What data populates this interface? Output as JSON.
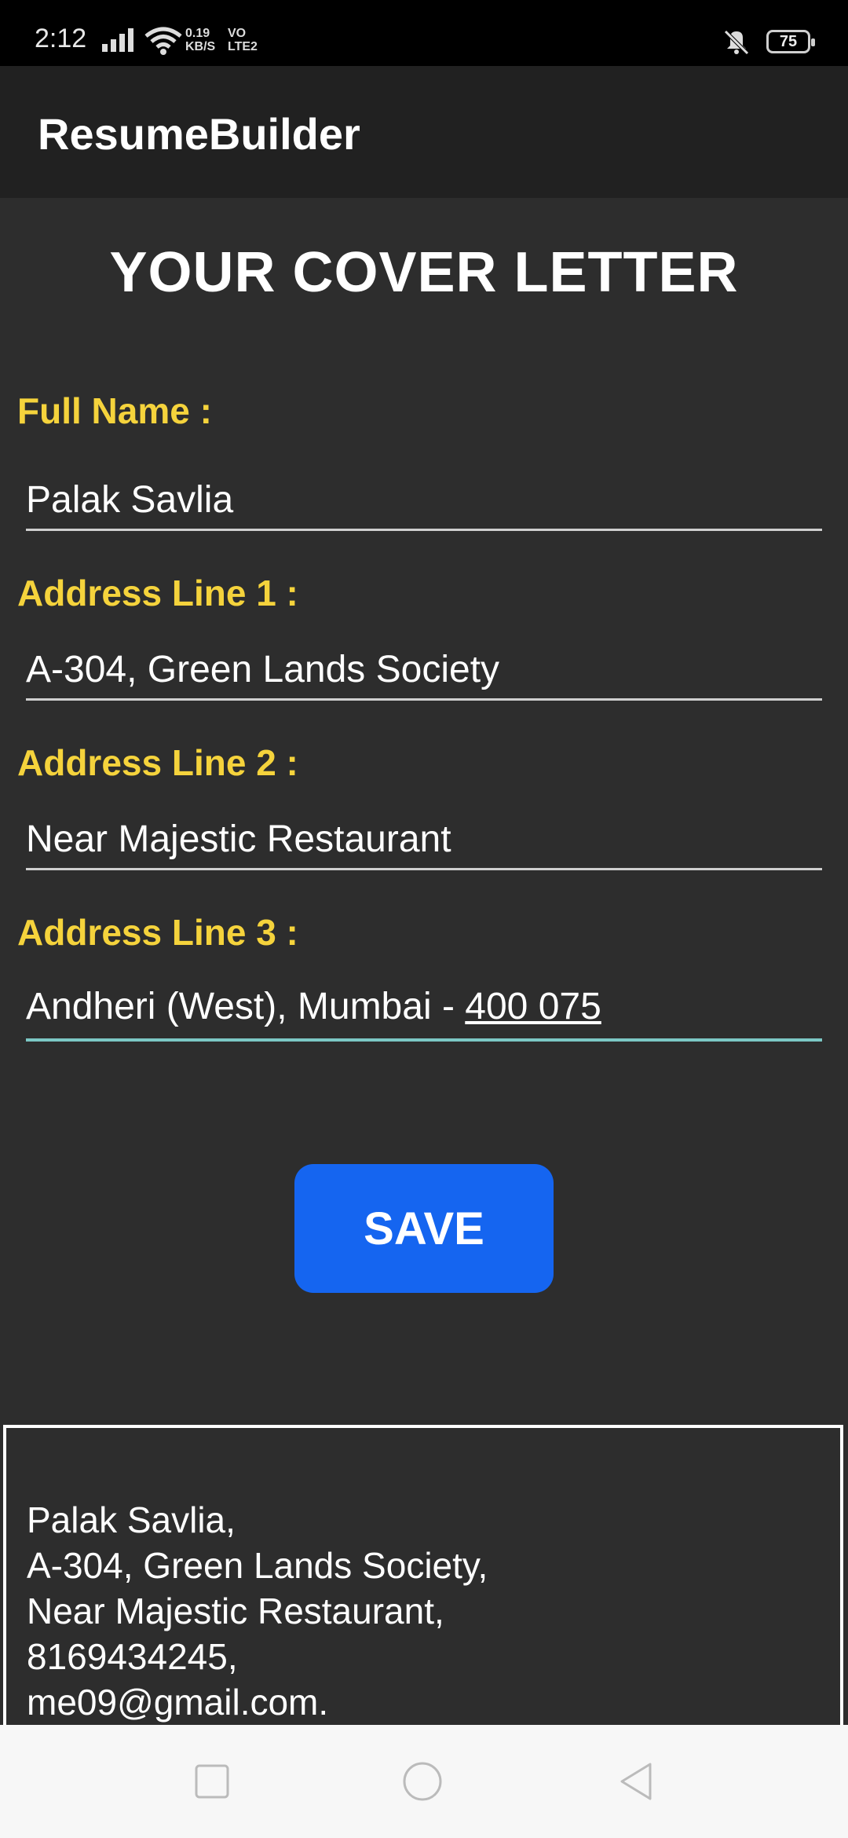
{
  "status_bar": {
    "time": "2:12",
    "net_speed_value": "0.19",
    "net_speed_unit": "KB/S",
    "volte_top": "VO",
    "volte_bottom": "LTE2",
    "battery": "75"
  },
  "app_bar": {
    "title": "ResumeBuilder"
  },
  "page": {
    "heading": "YOUR COVER LETTER"
  },
  "form": {
    "full_name_label": "Full Name :",
    "full_name_value": "Palak Savlia",
    "address1_label": "Address Line 1 :",
    "address1_value": "A-304, Green Lands Society",
    "address2_label": "Address Line 2 :",
    "address2_value": "Near Majestic Restaurant",
    "address3_label": "Address Line 3 :",
    "address3_value_prefix": "Andheri (West), Mumbai - ",
    "address3_value_zip": "400 075"
  },
  "save_label": "SAVE",
  "preview": {
    "lines": [
      "Palak Savlia,",
      "A-304, Green Lands Society,",
      "Near Majestic Restaurant,",
      "8169434245,",
      "me09@gmail.com."
    ]
  },
  "colors": {
    "label": "#f5d33c",
    "button": "#1565f0",
    "focus_underline": "#7cc7c5",
    "background": "#2d2d2d",
    "app_bar": "#212121"
  },
  "icons": {
    "status": [
      "signal-icon",
      "wifi-icon",
      "mute-icon",
      "battery-icon"
    ],
    "nav": [
      "recents-icon",
      "home-icon",
      "back-icon"
    ]
  }
}
